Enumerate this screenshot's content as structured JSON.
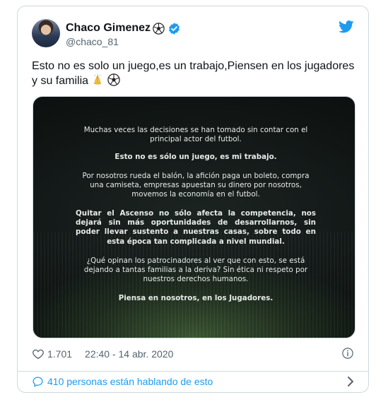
{
  "tweet": {
    "author_name": "Chaco Gimenez",
    "author_handle": "@chaco_81",
    "text": "Esto no es solo un juego,es un trabajo,Piensen en los jugadores y su familia",
    "likes": "1.701",
    "timestamp": "22:40 - 14 abr. 2020",
    "talking_about": "410 personas están hablando de esto"
  },
  "image_text": {
    "p1": "Muchas veces las decisiones se han tomado sin contar con el principal actor del futbol.",
    "p2": "Esto no es sólo un juego, es mi trabajo.",
    "p3": "Por nosotros rueda el balón, la afición paga un boleto, compra una camiseta, empresas apuestan su dinero por nosotros, movemos la economía en el futbol.",
    "p4": "Quitar el Ascenso no sólo afecta la competencia, nos dejará sin más oportunidades de desarrollarnos, sin poder llevar sustento a nuestras casas, sobre todo en esta época tan complicada a nivel mundial.",
    "p5": "¿Qué opinan los patrocinadores al ver que con esto, se está dejando a tantas familias a la deriva? Sin ética ni respeto por nuestros derechos humanos.",
    "p6": "Piensa en nosotros, en los Jugadores."
  },
  "icons": {
    "verified": "verified-badge-icon",
    "twitter": "twitter-bird-icon",
    "emoji_name": "soccer-ball-icon",
    "emoji_text_1": "folded-hands-icon",
    "emoji_text_2": "soccer-ball-icon",
    "heart": "heart-icon",
    "info": "info-icon",
    "reply": "speech-bubble-icon",
    "chevron": "chevron-right-icon"
  },
  "colors": {
    "accent": "#1d9bf0",
    "text": "#0f1419",
    "muted": "#536471"
  }
}
